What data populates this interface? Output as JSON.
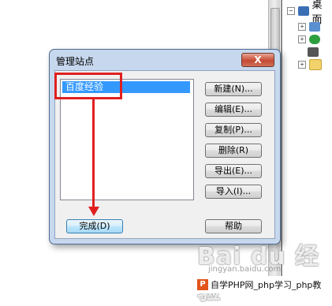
{
  "dialog": {
    "title": "管理站点",
    "close_label": "X",
    "sites": [
      "百度经验"
    ],
    "buttons": {
      "new": "新建(N)...",
      "edit": "编辑(E)...",
      "copy": "复制(P)...",
      "delete": "删除(R)",
      "export": "导出(E)...",
      "import": "导入(I)...",
      "done": "完成(D)",
      "help": "帮助"
    }
  },
  "tree": {
    "root_expander": "−",
    "root_label": "桌面",
    "expanders": [
      "+",
      "+",
      "+"
    ]
  },
  "watermark": {
    "logo": "Bai du 经验",
    "url": "jingyan.baidu.com"
  },
  "banner": {
    "badge": "P",
    "text": "自学PHP网_php学习_php教"
  },
  "colors": {
    "annotation_red": "#e02020",
    "selection": "#3399ff"
  }
}
